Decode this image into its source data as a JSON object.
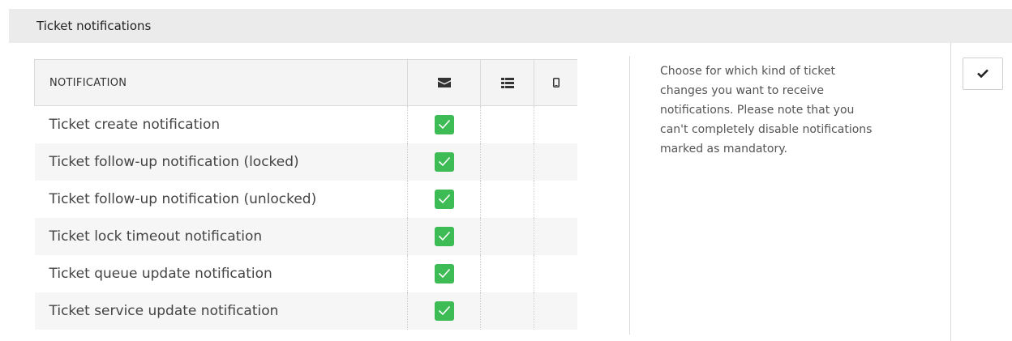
{
  "panel": {
    "title": "Ticket notifications"
  },
  "table": {
    "header": {
      "notification_label": "NOTIFICATION",
      "columns": [
        {
          "icon": "envelope-icon"
        },
        {
          "icon": "list-icon"
        },
        {
          "icon": "mobile-icon"
        }
      ]
    },
    "rows": [
      {
        "label": "Ticket create notification",
        "email": true,
        "web": false,
        "sms": false
      },
      {
        "label": "Ticket follow-up notification (locked)",
        "email": true,
        "web": false,
        "sms": false
      },
      {
        "label": "Ticket follow-up notification (unlocked)",
        "email": true,
        "web": false,
        "sms": false
      },
      {
        "label": "Ticket lock timeout notification",
        "email": true,
        "web": false,
        "sms": false
      },
      {
        "label": "Ticket queue update notification",
        "email": true,
        "web": false,
        "sms": false
      },
      {
        "label": "Ticket service update notification",
        "email": true,
        "web": false,
        "sms": false
      }
    ]
  },
  "help": {
    "text": "Choose for which kind of ticket changes you want to receive notifications. Please note that you can't completely disable notifications marked as mandatory."
  },
  "actions": {
    "save_icon": "checkmark-icon"
  },
  "colors": {
    "checkbox_checked": "#3dbb55",
    "header_bg": "#ebebeb"
  }
}
